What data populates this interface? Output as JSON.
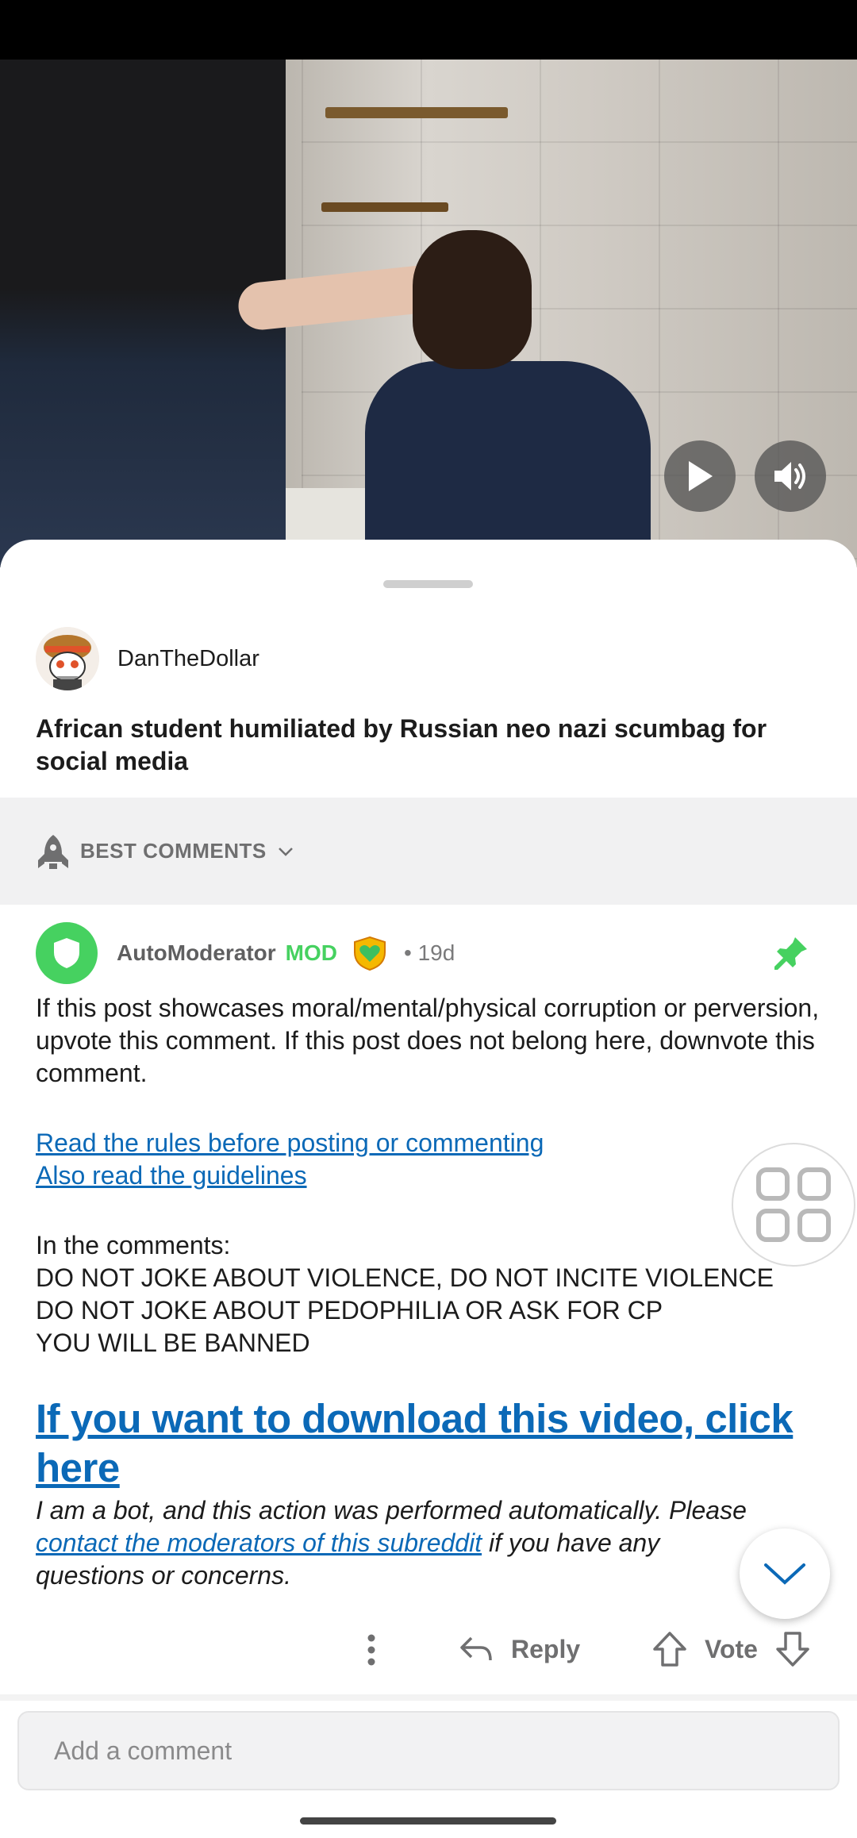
{
  "video": {
    "play_icon": "play-icon",
    "volume_icon": "volume-icon"
  },
  "post": {
    "author": "DanTheDollar",
    "title": "African student humiliated by Russian neo nazi scumbag for social media"
  },
  "sort": {
    "label": "BEST COMMENTS",
    "icon": "rocket-icon"
  },
  "comment": {
    "author": "AutoModerator",
    "mod_badge": "MOD",
    "age": "• 19d",
    "pinned": true,
    "paragraph1": "If this post showcases moral/mental/physical corruption or perversion, upvote this comment.  If this post does not belong here, downvote this comment.",
    "rules_link": "Read the rules before posting or commenting",
    "guidelines_link": "Also read the guidelines",
    "in_comments": "In the comments:",
    "rule1": "DO NOT JOKE ABOUT VIOLENCE, DO NOT INCITE VIOLENCE",
    "rule2": "DO NOT JOKE ABOUT PEDOPHILIA OR ASK FOR CP",
    "rule3": "YOU WILL BE BANNED",
    "download_link": "If you want to download this video, click here",
    "bot_note_1": "I am a bot, and this action was performed automatically.",
    "bot_note_please": "Please ",
    "contact_link": "contact the moderators of this subreddit",
    "bot_note_2": " if you have any questions or concerns."
  },
  "actions": {
    "reply": "Reply",
    "vote": "Vote"
  },
  "composer": {
    "placeholder": "Add a comment"
  },
  "colors": {
    "accent_green": "#46d160",
    "link_blue": "#0b69b7"
  }
}
